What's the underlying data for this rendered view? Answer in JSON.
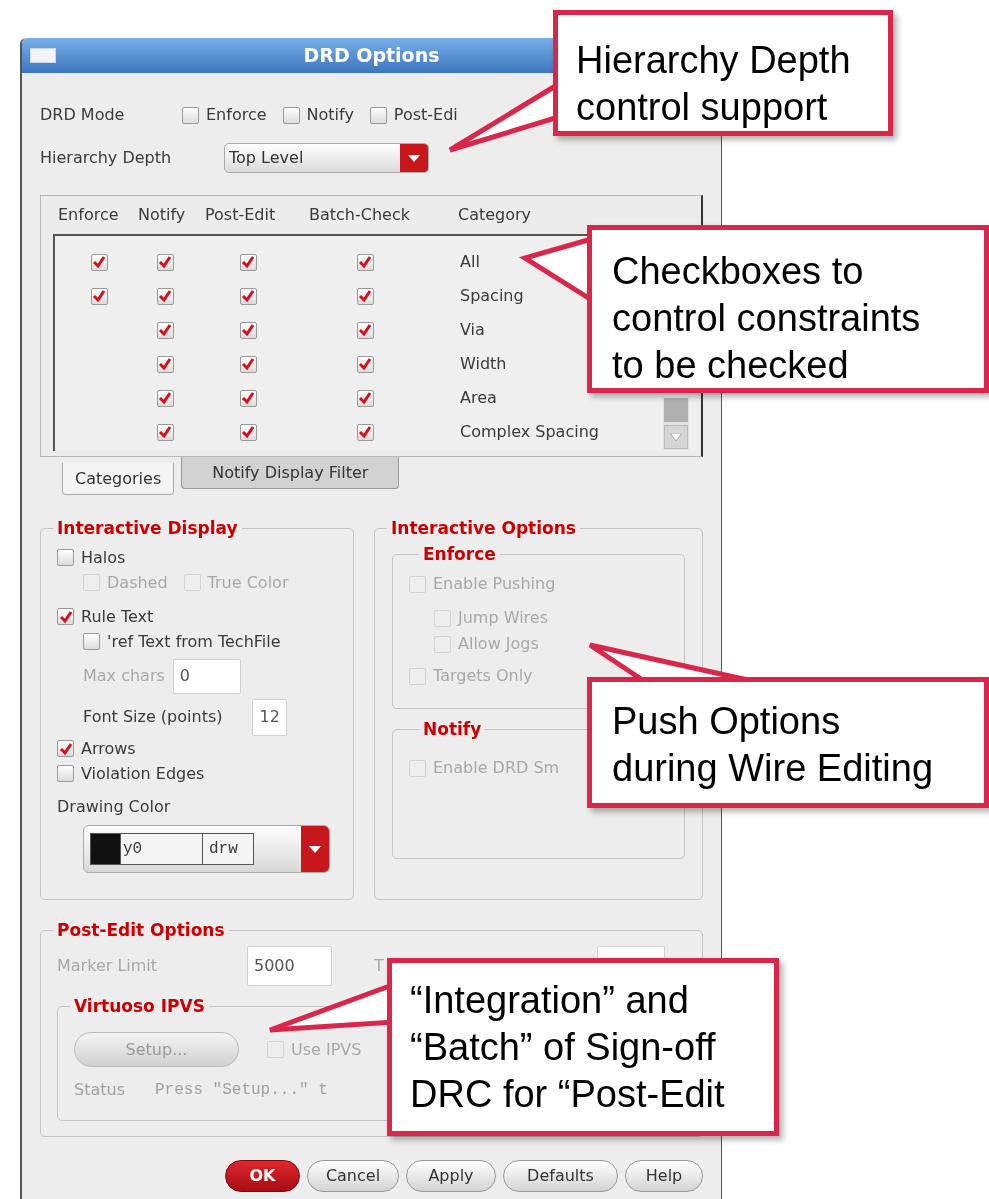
{
  "window": {
    "title": "DRD Options"
  },
  "drd_mode": {
    "label": "DRD Mode",
    "options": [
      {
        "label": "Enforce",
        "checked": false
      },
      {
        "label": "Notify",
        "checked": false
      },
      {
        "label": "Post-Edi",
        "checked": false
      }
    ]
  },
  "hierarchy_depth": {
    "label": "Hierarchy Depth",
    "value": "Top Level"
  },
  "categories_table": {
    "columns": [
      "Enforce",
      "Notify",
      "Post-Edit",
      "Batch-Check",
      "Category"
    ],
    "rows": [
      {
        "enforce": true,
        "notify": true,
        "post_edit": true,
        "batch_check": true,
        "category": "All"
      },
      {
        "enforce": true,
        "notify": true,
        "post_edit": true,
        "batch_check": true,
        "category": "Spacing"
      },
      {
        "notify": true,
        "post_edit": true,
        "batch_check": true,
        "category": "Via"
      },
      {
        "notify": true,
        "post_edit": true,
        "batch_check": true,
        "category": "Width"
      },
      {
        "notify": true,
        "post_edit": true,
        "batch_check": true,
        "category": "Area"
      },
      {
        "notify": true,
        "post_edit": true,
        "batch_check": true,
        "category": "Complex Spacing"
      }
    ]
  },
  "tabs": [
    {
      "label": "Categories",
      "selected": true
    },
    {
      "label": "Notify Display Filter",
      "selected": false
    }
  ],
  "interactive_display": {
    "title": "Interactive Display",
    "items": [
      {
        "kind": "checkbox",
        "label": "Halos",
        "checked": false,
        "disabled": false,
        "children": [
          {
            "kind": "checkbox",
            "label": "Dashed",
            "checked": false,
            "disabled": true
          },
          {
            "kind": "checkbox",
            "label": "True Color",
            "checked": false,
            "disabled": true
          }
        ]
      },
      {
        "kind": "checkbox",
        "label": "Rule Text",
        "checked": true,
        "disabled": false,
        "children": [
          {
            "kind": "checkbox",
            "label": "'ref Text from TechFile",
            "checked": false,
            "disabled": false
          },
          {
            "kind": "field",
            "label": "Max chars",
            "value": "0",
            "disabled": true
          },
          {
            "kind": "field",
            "label": "Font Size (points)",
            "value": "12",
            "disabled": false
          }
        ]
      },
      {
        "kind": "checkbox",
        "label": "Arrows",
        "checked": true,
        "disabled": false
      },
      {
        "kind": "checkbox",
        "label": "Violation Edges",
        "checked": false,
        "disabled": false
      }
    ],
    "drawing_color": {
      "label": "Drawing Color",
      "layer": "y0",
      "purpose": "drw"
    }
  },
  "interactive_options": {
    "title": "Interactive Options",
    "groups": [
      {
        "title": "Enforce",
        "items": [
          {
            "label": "Enable Pushing",
            "checked": false,
            "disabled": true,
            "children": [
              {
                "label": "Jump Wires",
                "checked": false,
                "disabled": true
              },
              {
                "label": "Allow Jogs",
                "checked": false,
                "disabled": true
              }
            ]
          },
          {
            "label": "Targets Only",
            "checked": false,
            "disabled": true
          }
        ]
      },
      {
        "title": "Notify",
        "items": [
          {
            "label": "Enable DRD Sm",
            "checked": false,
            "disabled": true
          }
        ]
      }
    ]
  },
  "post_edit_options": {
    "title": "Post-Edit Options",
    "marker_limit": {
      "label": "Marker Limit",
      "value": "5000",
      "disabled": true
    },
    "label_2": "T",
    "virtuoso_ipvs": {
      "title": "Virtuoso IPVS",
      "setup_button": {
        "label": "Setup...",
        "disabled": true
      },
      "use_ipvs": {
        "label": "Use IPVS",
        "checked": false,
        "disabled": true
      },
      "status": {
        "label": "Status",
        "value": "Press \"Setup...\" t"
      }
    }
  },
  "buttons": [
    {
      "label": "OK",
      "kind": "default"
    },
    {
      "label": "Cancel",
      "kind": "normal"
    },
    {
      "label": "Apply",
      "kind": "normal"
    },
    {
      "label": "Defaults",
      "kind": "normal"
    },
    {
      "label": "Help",
      "kind": "normal"
    }
  ],
  "callouts": [
    {
      "text": "Hierarchy Depth control support"
    },
    {
      "text": "Checkboxes to control constraints to be checked"
    },
    {
      "text": "Push Options\nduring Wire Editing"
    },
    {
      "text": "“Integration” and “Batch” of Sign-off DRC for “Post-Edit"
    }
  ]
}
